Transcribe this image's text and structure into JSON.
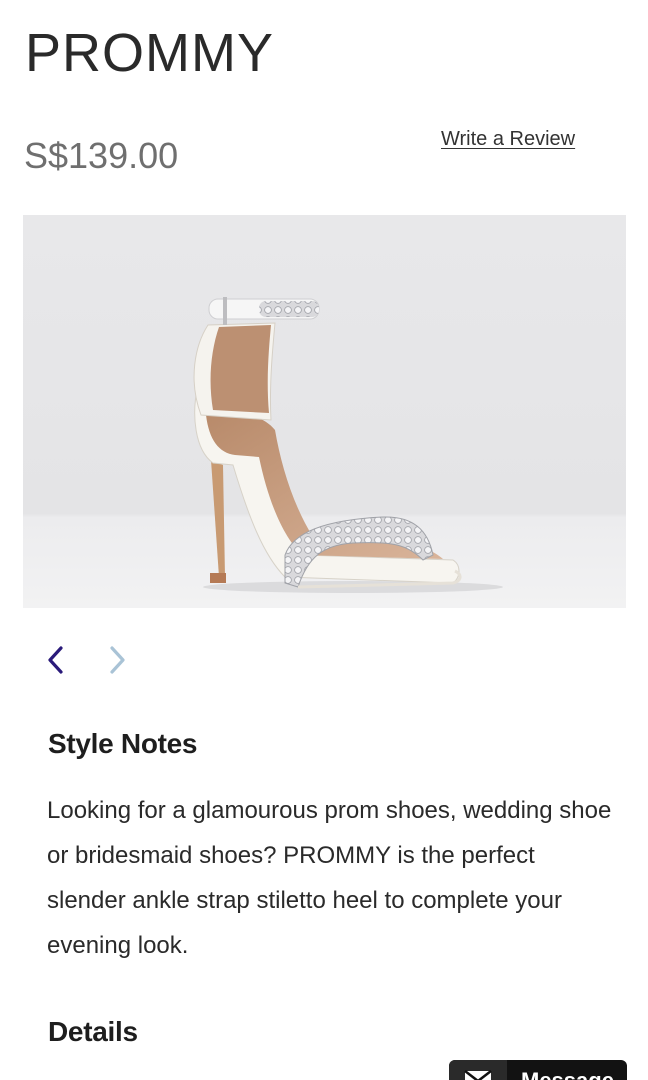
{
  "product": {
    "title": "PROMMY",
    "price": "S$139.00",
    "review_link": "Write a Review"
  },
  "image": {
    "alt": "White ankle strap stiletto sandal with embellished toe strap"
  },
  "carousel": {
    "prev_icon": "chevron-left-icon",
    "next_icon": "chevron-right-icon",
    "prev_color": "#2a1a7a",
    "next_color": "#a9c3d6"
  },
  "style_notes": {
    "heading": "Style Notes",
    "text": "Looking for a glamourous prom shoes, wedding shoe or bridesmaid shoes? PROMMY is the perfect slender ankle strap stiletto heel to complete your evening look."
  },
  "details": {
    "heading": "Details"
  },
  "message_button": {
    "label": "Message",
    "icon": "mail-icon"
  }
}
